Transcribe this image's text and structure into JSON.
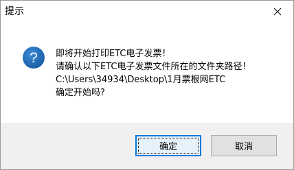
{
  "dialog": {
    "title": "提示",
    "message_lines": [
      "即将开始打印ETC电子发票！",
      "请确认以下ETC电子发票文件所在的文件夹路径！",
      "C:\\Users\\34934\\Desktop\\1月票根网ETC",
      "确定开始吗?"
    ],
    "icon": "question-icon",
    "buttons": {
      "ok_label": "确定",
      "cancel_label": "取消"
    },
    "close_icon": "close-icon"
  },
  "colors": {
    "icon_blue": "#1f6fb5",
    "focus_border": "#0078d7",
    "footer_bg": "#f0f0f0"
  }
}
